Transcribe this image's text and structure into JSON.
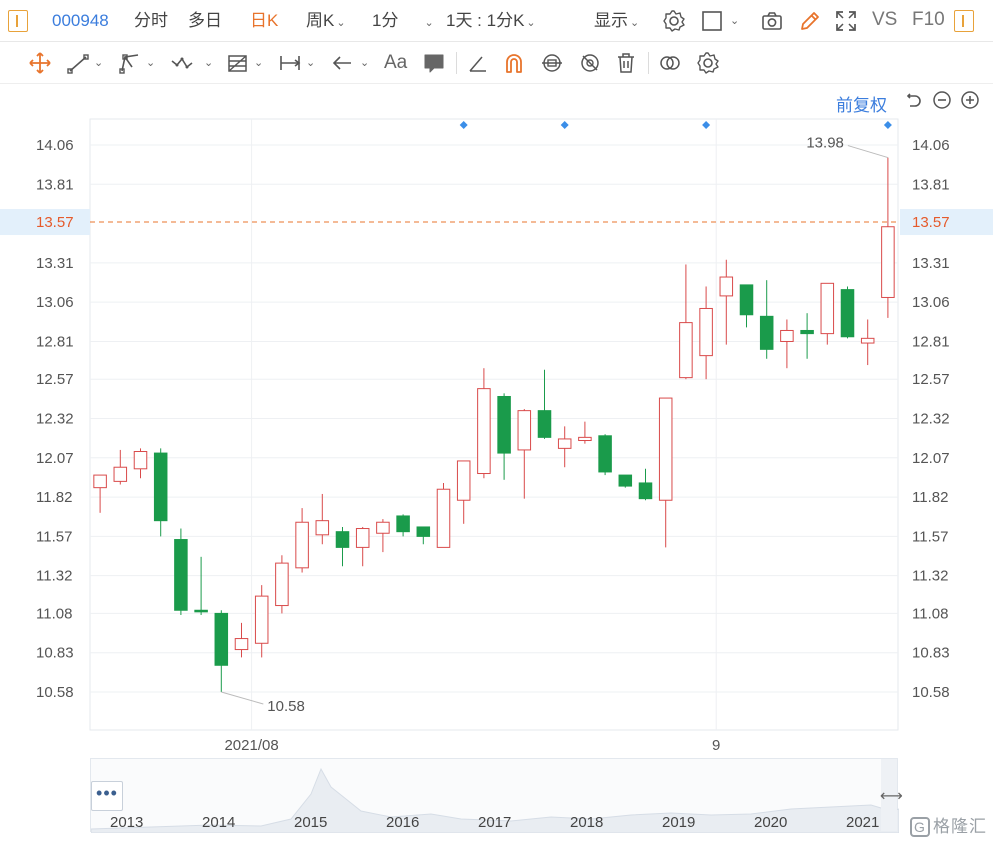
{
  "topbar": {
    "code": "000948",
    "tabs": [
      {
        "label": "分时",
        "active": false
      },
      {
        "label": "多日",
        "active": false
      },
      {
        "label": "日K",
        "active": true
      },
      {
        "label": "周K",
        "active": false
      },
      {
        "label": "1分",
        "active": false
      }
    ],
    "period_combo": "1天 : 1分K",
    "display_label": "显示",
    "vs_label": "VS",
    "f10_label": "F10",
    "accent_color": "#e8742c",
    "code_color": "#3b7ddd"
  },
  "toolbar2": {
    "text_tool": "Aa"
  },
  "adjust_label": "前复权",
  "chart_data": {
    "type": "candlestick",
    "y_ticks": [
      "14.06",
      "13.81",
      "13.57",
      "13.31",
      "13.06",
      "12.81",
      "12.57",
      "12.32",
      "12.07",
      "11.82",
      "11.57",
      "11.32",
      "11.08",
      "10.83",
      "10.58"
    ],
    "current_price": "13.57",
    "high_label": "13.98",
    "low_label": "10.58",
    "x_labels": [
      {
        "label": "2021/08",
        "index": 8
      },
      {
        "label": "9",
        "index": 31
      }
    ],
    "up_color": "#d94a4a",
    "down_color": "#1a9b4b",
    "candles": [
      {
        "o": 11.88,
        "c": 11.96,
        "h": 11.96,
        "l": 11.72
      },
      {
        "o": 11.92,
        "c": 12.01,
        "h": 12.12,
        "l": 11.9
      },
      {
        "o": 12.0,
        "c": 12.11,
        "h": 12.13,
        "l": 11.94
      },
      {
        "o": 12.1,
        "c": 11.67,
        "h": 12.13,
        "l": 11.57
      },
      {
        "o": 11.55,
        "c": 11.1,
        "h": 11.62,
        "l": 11.07
      },
      {
        "o": 11.1,
        "c": 11.09,
        "h": 11.44,
        "l": 11.07
      },
      {
        "o": 11.08,
        "c": 10.75,
        "h": 11.1,
        "l": 10.58
      },
      {
        "o": 10.85,
        "c": 10.92,
        "h": 11.02,
        "l": 10.8
      },
      {
        "o": 10.89,
        "c": 11.19,
        "h": 11.26,
        "l": 10.8
      },
      {
        "o": 11.13,
        "c": 11.4,
        "h": 11.45,
        "l": 11.08
      },
      {
        "o": 11.37,
        "c": 11.66,
        "h": 11.75,
        "l": 11.34
      },
      {
        "o": 11.58,
        "c": 11.67,
        "h": 11.84,
        "l": 11.52
      },
      {
        "o": 11.6,
        "c": 11.5,
        "h": 11.63,
        "l": 11.38
      },
      {
        "o": 11.5,
        "c": 11.62,
        "h": 11.63,
        "l": 11.38
      },
      {
        "o": 11.59,
        "c": 11.66,
        "h": 11.68,
        "l": 11.47
      },
      {
        "o": 11.7,
        "c": 11.6,
        "h": 11.71,
        "l": 11.57
      },
      {
        "o": 11.63,
        "c": 11.57,
        "h": 11.63,
        "l": 11.52
      },
      {
        "o": 11.5,
        "c": 11.87,
        "h": 11.91,
        "l": 11.5
      },
      {
        "o": 11.8,
        "c": 12.05,
        "h": 11.96,
        "l": 11.65
      },
      {
        "o": 11.97,
        "c": 12.51,
        "h": 12.64,
        "l": 11.94
      },
      {
        "o": 12.46,
        "c": 12.1,
        "h": 12.48,
        "l": 11.93
      },
      {
        "o": 12.12,
        "c": 12.37,
        "h": 12.38,
        "l": 11.81
      },
      {
        "o": 12.37,
        "c": 12.2,
        "h": 12.63,
        "l": 12.19
      },
      {
        "o": 12.13,
        "c": 12.19,
        "h": 12.27,
        "l": 12.01
      },
      {
        "o": 12.18,
        "c": 12.2,
        "h": 12.3,
        "l": 12.16
      },
      {
        "o": 12.21,
        "c": 11.98,
        "h": 12.22,
        "l": 11.96
      },
      {
        "o": 11.96,
        "c": 11.89,
        "h": 11.96,
        "l": 11.88
      },
      {
        "o": 11.91,
        "c": 11.81,
        "h": 12.0,
        "l": 11.8
      },
      {
        "o": 11.8,
        "c": 12.45,
        "h": 12.45,
        "l": 11.5
      },
      {
        "o": 12.58,
        "c": 12.93,
        "h": 13.3,
        "l": 12.57
      },
      {
        "o": 12.72,
        "c": 13.02,
        "h": 13.16,
        "l": 12.57
      },
      {
        "o": 13.1,
        "c": 13.22,
        "h": 13.33,
        "l": 12.79
      },
      {
        "o": 13.17,
        "c": 12.98,
        "h": 13.17,
        "l": 12.9
      },
      {
        "o": 12.97,
        "c": 12.76,
        "h": 13.2,
        "l": 12.7
      },
      {
        "o": 12.81,
        "c": 12.88,
        "h": 12.95,
        "l": 12.64
      },
      {
        "o": 12.88,
        "c": 12.86,
        "h": 12.99,
        "l": 12.7
      },
      {
        "o": 12.86,
        "c": 13.18,
        "h": 13.18,
        "l": 12.79
      },
      {
        "o": 13.14,
        "c": 12.84,
        "h": 13.16,
        "l": 12.83
      },
      {
        "o": 12.8,
        "c": 12.83,
        "h": 12.95,
        "l": 12.66
      },
      {
        "o": 13.09,
        "c": 13.54,
        "h": 13.98,
        "l": 12.96
      }
    ],
    "event_markers": [
      18,
      23,
      30,
      39
    ],
    "navigator_years": [
      "2013",
      "2014",
      "2015",
      "2016",
      "2017",
      "2018",
      "2019",
      "2020",
      "2021"
    ]
  },
  "navigator": {
    "handle_label": "•••",
    "arrow_label": "⟷"
  },
  "watermark": "格隆汇"
}
